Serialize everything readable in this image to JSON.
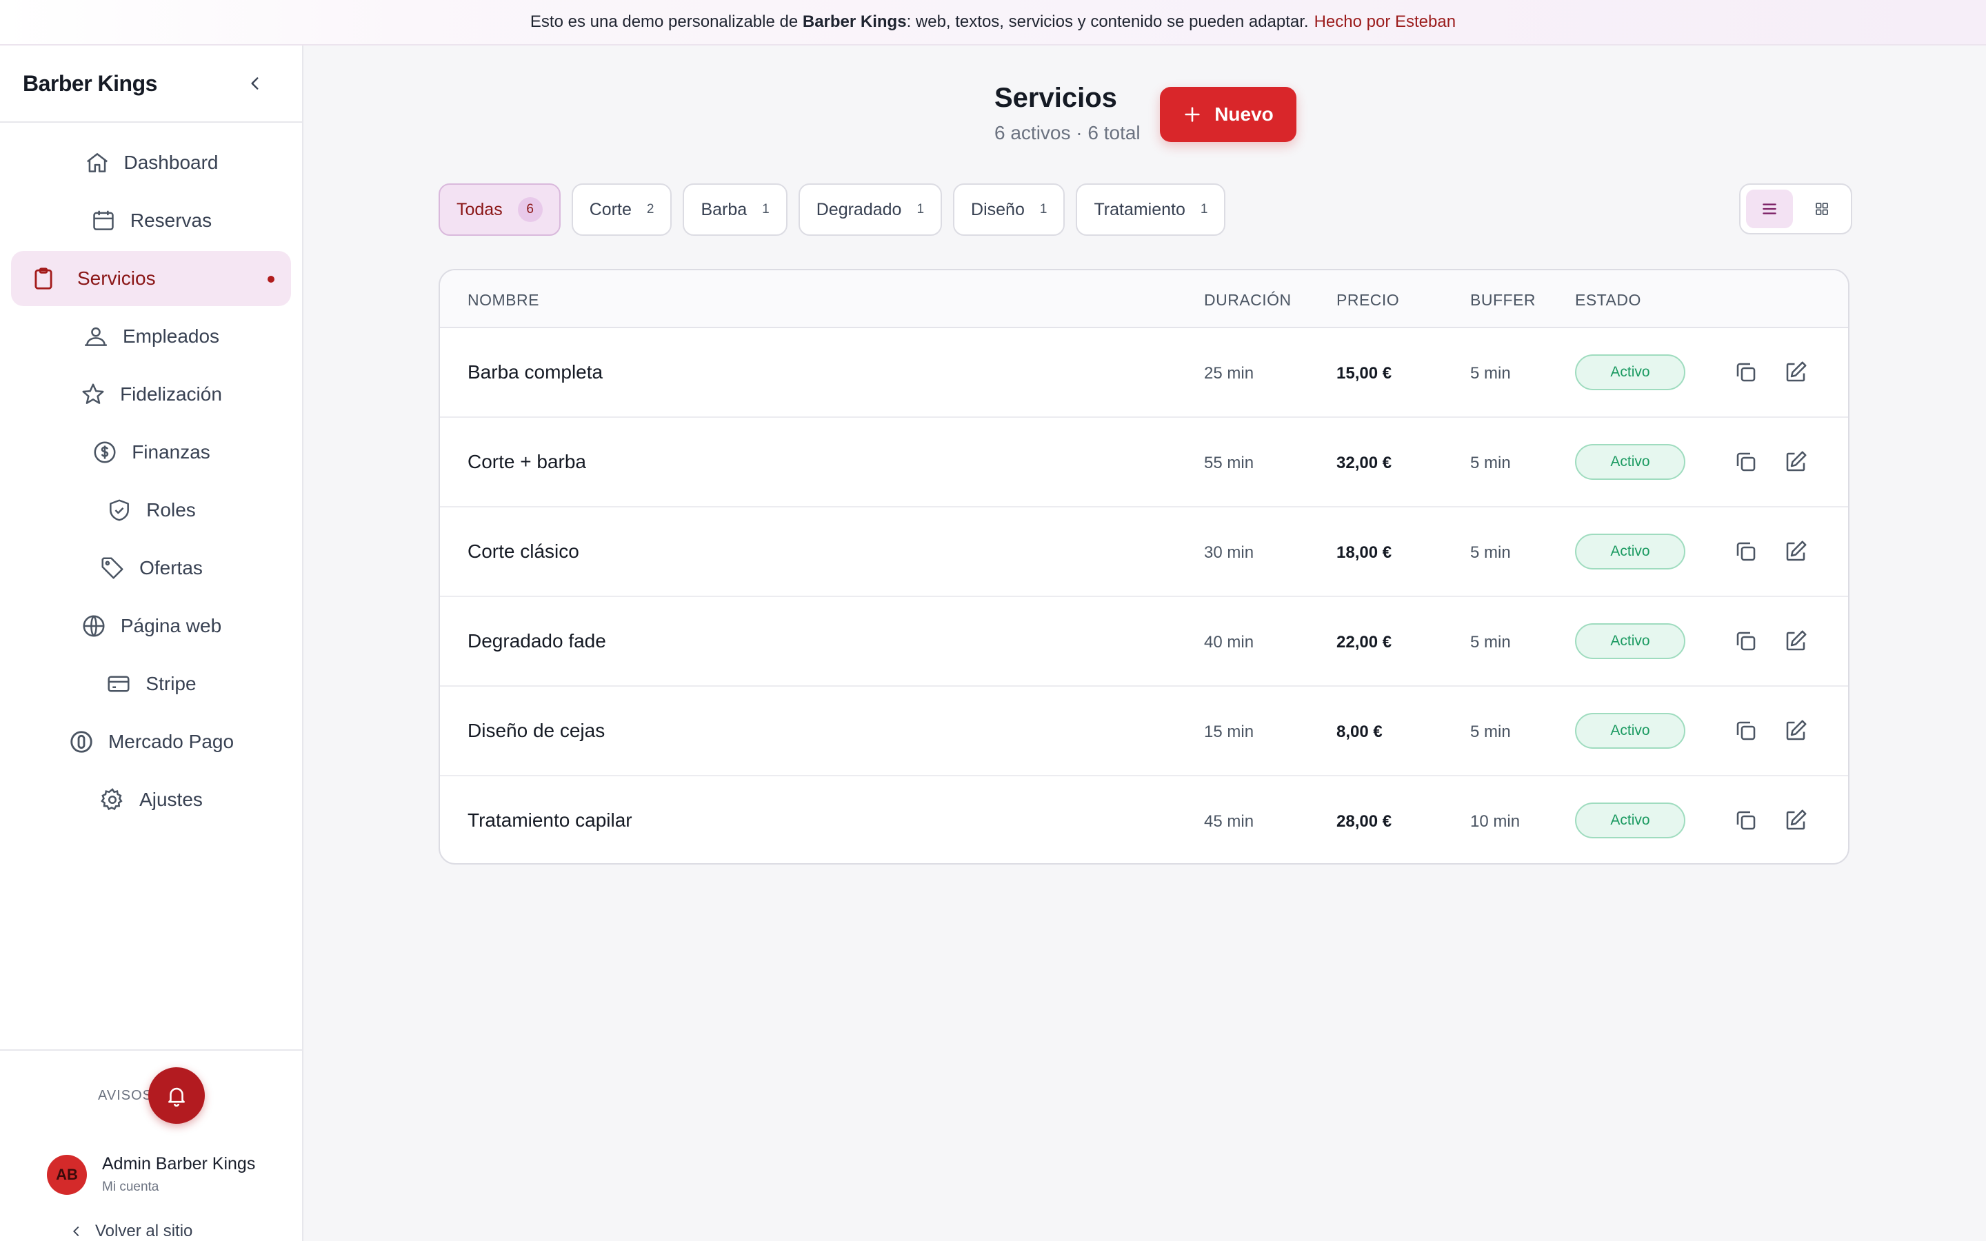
{
  "banner": {
    "text_before": "Esto es una demo personalizable de",
    "brand": "Barber Kings",
    "text_after": ": web, textos, servicios y contenido se pueden adaptar.",
    "link": "Hecho por Esteban"
  },
  "sidebar": {
    "brand": "Barber Kings",
    "items": [
      {
        "label": "Dashboard",
        "icon": "home-icon"
      },
      {
        "label": "Reservas",
        "icon": "calendar-icon"
      },
      {
        "label": "Servicios",
        "icon": "clipboard-icon",
        "active": true
      },
      {
        "label": "Empleados",
        "icon": "users-icon"
      },
      {
        "label": "Fidelización",
        "icon": "star-icon"
      },
      {
        "label": "Finanzas",
        "icon": "dollar-icon"
      },
      {
        "label": "Roles",
        "icon": "shield-icon"
      },
      {
        "label": "Ofertas",
        "icon": "tag-icon"
      },
      {
        "label": "Página web",
        "icon": "globe-icon"
      },
      {
        "label": "Stripe",
        "icon": "card-icon"
      },
      {
        "label": "Mercado Pago",
        "icon": "mercadopago-icon"
      },
      {
        "label": "Ajustes",
        "icon": "gear-icon"
      }
    ],
    "footer": {
      "avisos_label": "AVISOS",
      "user_initials": "AB",
      "user_name": "Admin Barber Kings",
      "user_sub": "Mi cuenta",
      "back_label": "Volver al sitio"
    }
  },
  "header": {
    "title": "Servicios",
    "subtitle": "6 activos · 6 total",
    "new_label": "Nuevo"
  },
  "filters": [
    {
      "label": "Todas",
      "count": "6",
      "active": true
    },
    {
      "label": "Corte",
      "count": "2"
    },
    {
      "label": "Barba",
      "count": "1"
    },
    {
      "label": "Degradado",
      "count": "1"
    },
    {
      "label": "Diseño",
      "count": "1"
    },
    {
      "label": "Tratamiento",
      "count": "1"
    }
  ],
  "table": {
    "columns": [
      "NOMBRE",
      "DURACIÓN",
      "PRECIO",
      "BUFFER",
      "ESTADO"
    ],
    "rows": [
      {
        "name": "Barba completa",
        "duration": "25 min",
        "price": "15,00 €",
        "buffer": "5 min",
        "status": "Activo"
      },
      {
        "name": "Corte + barba",
        "duration": "55 min",
        "price": "32,00 €",
        "buffer": "5 min",
        "status": "Activo"
      },
      {
        "name": "Corte clásico",
        "duration": "30 min",
        "price": "18,00 €",
        "buffer": "5 min",
        "status": "Activo"
      },
      {
        "name": "Degradado fade",
        "duration": "40 min",
        "price": "22,00 €",
        "buffer": "5 min",
        "status": "Activo"
      },
      {
        "name": "Diseño de cejas",
        "duration": "15 min",
        "price": "8,00 €",
        "buffer": "5 min",
        "status": "Activo"
      },
      {
        "name": "Tratamiento capilar",
        "duration": "45 min",
        "price": "28,00 €",
        "buffer": "10 min",
        "status": "Activo"
      }
    ]
  },
  "colors": {
    "accent": "#d9262a",
    "active_bg": "#f5e6f3",
    "status_green": "#1b9a61"
  }
}
